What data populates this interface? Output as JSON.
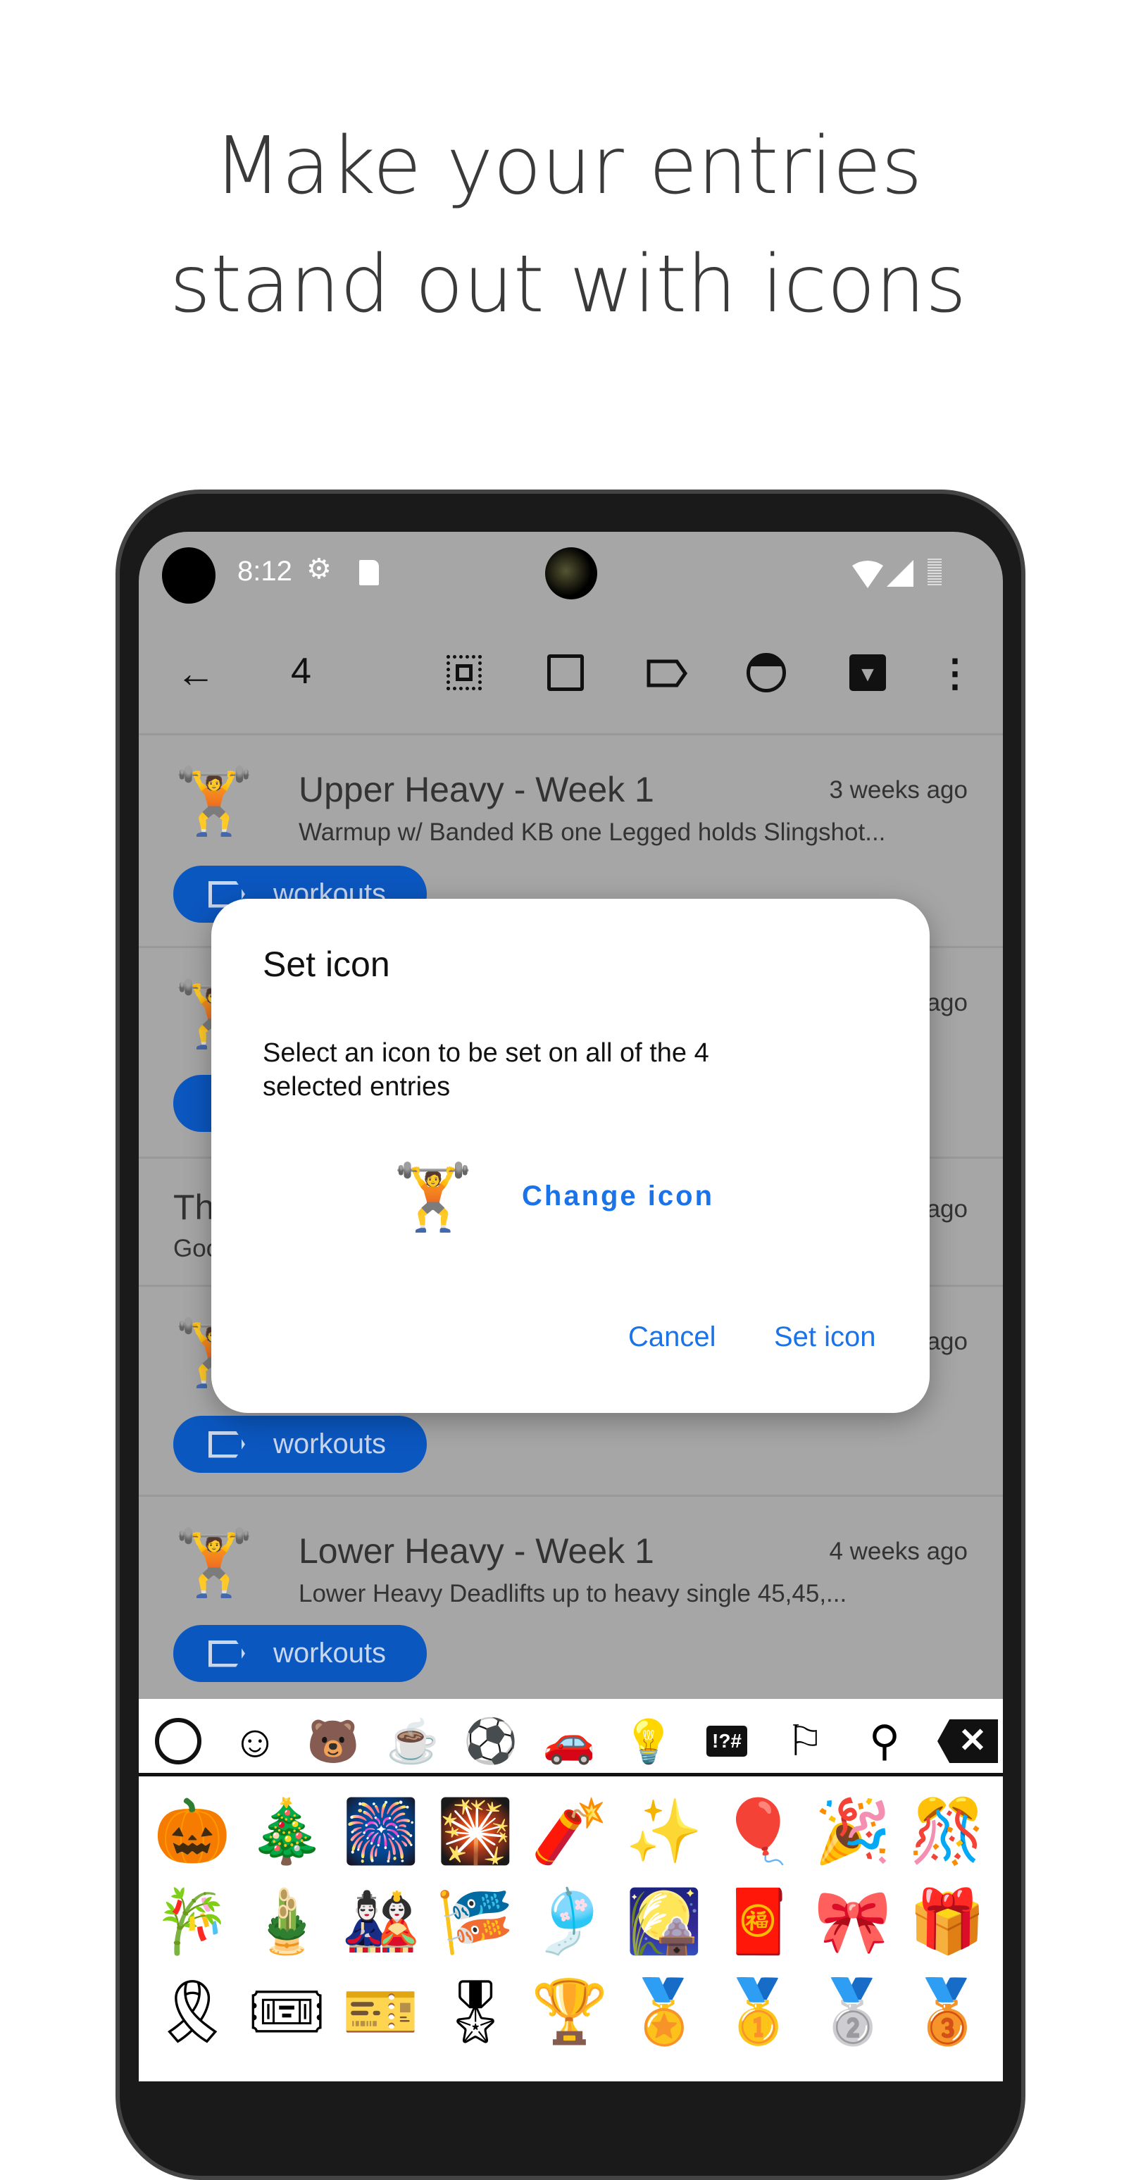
{
  "headline": {
    "line1": "Make your entries",
    "line2": "stand out with icons"
  },
  "status_bar": {
    "time": "8:12"
  },
  "toolbar": {
    "selected_count": "4",
    "icons": [
      "back-arrow",
      "select-all",
      "deselect",
      "label",
      "face",
      "archive",
      "more-vert"
    ]
  },
  "entries": [
    {
      "icon": "🏋",
      "title": "Upper Heavy - Week 1",
      "time": "3 weeks ago",
      "preview": "Warmup w/ Banded KB one Legged holds  Slingshot...",
      "tag": "workouts"
    },
    {
      "icon": "🏋",
      "title": "",
      "time": "ago",
      "preview": "",
      "tag": ""
    },
    {
      "icon": "",
      "title": "Th",
      "time": "ago",
      "preview": "Goo",
      "tag": ""
    },
    {
      "icon": "🏋",
      "title": "",
      "time": "ago",
      "preview": "",
      "tag": "workouts"
    },
    {
      "icon": "🏋",
      "title": "Lower Heavy - Week 1",
      "time": "4 weeks ago",
      "preview": "Lower Heavy Deadlifts up to heavy single 45,45,...",
      "tag": "workouts"
    }
  ],
  "dialog": {
    "title": "Set icon",
    "message_line1": "Select an icon to be set on all of the 4",
    "message_line2": "selected entries",
    "icon": "🏋",
    "change_label": "Change icon",
    "cancel_label": "Cancel",
    "confirm_label": "Set icon"
  },
  "emoji_keyboard": {
    "tabs": [
      "recent",
      "smileys",
      "animals",
      "food",
      "activities",
      "travel",
      "objects",
      "symbols",
      "flags",
      "search",
      "backspace"
    ],
    "active_tab": "activities",
    "rows": [
      [
        "🎃",
        "🎄",
        "🎆",
        "🎇",
        "🧨",
        "✨",
        "🎈",
        "🎉",
        "🎊"
      ],
      [
        "🎋",
        "🎍",
        "🎎",
        "🎏",
        "🎐",
        "🎑",
        "🧧",
        "🎀",
        "🎁"
      ],
      [
        "🎗",
        "🎟",
        "🎫",
        "🎖",
        "🏆",
        "🏅",
        "🥇",
        "🥈",
        "🥉"
      ]
    ]
  },
  "colors": {
    "accent": "#1a73e8",
    "chip": "#0b57c0",
    "scrim_bg": "#a6a6a6"
  }
}
